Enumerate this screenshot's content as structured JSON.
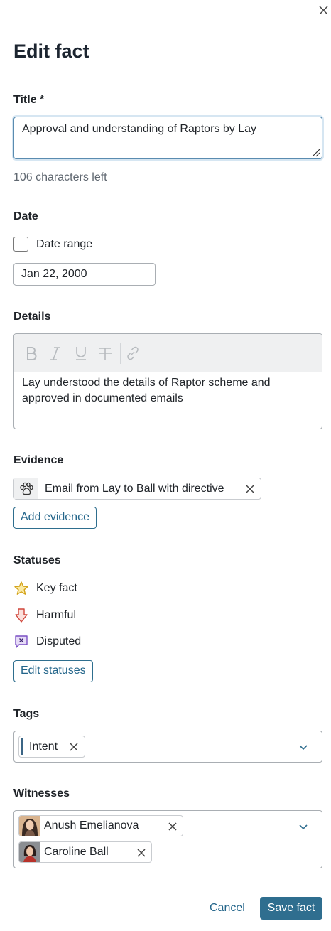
{
  "dialog": {
    "title": "Edit fact"
  },
  "title_field": {
    "label": "Title *",
    "value": "Approval and understanding of Raptors by Lay",
    "hint": "106 characters left"
  },
  "date": {
    "label": "Date",
    "range_checkbox_label": "Date range",
    "range_checked": false,
    "value": "Jan 22, 2000"
  },
  "details": {
    "label": "Details",
    "toolbar": [
      "bold-icon",
      "italic-icon",
      "underline-icon",
      "strikethrough-icon",
      "link-icon"
    ],
    "body": "Lay understood the details of Raptor scheme and approved in documented emails"
  },
  "evidence": {
    "label": "Evidence",
    "items": [
      {
        "icon": "paw-icon",
        "label": "Email from Lay to Ball with directive"
      }
    ],
    "add_button": "Add evidence"
  },
  "statuses": {
    "label": "Statuses",
    "items": [
      {
        "icon": "star-icon",
        "label": "Key fact",
        "color": "#e0b21a"
      },
      {
        "icon": "down-arrow-icon",
        "label": "Harmful",
        "color": "#d0453a"
      },
      {
        "icon": "disputed-bubble-icon",
        "label": "Disputed",
        "color": "#7a4fc4"
      }
    ],
    "edit_button": "Edit statuses"
  },
  "tags": {
    "label": "Tags",
    "items": [
      {
        "label": "Intent",
        "color": "#3b6585"
      }
    ]
  },
  "witnesses": {
    "label": "Witnesses",
    "items": [
      {
        "name": "Anush Emelianova"
      },
      {
        "name": "Caroline Ball"
      }
    ]
  },
  "footer": {
    "cancel": "Cancel",
    "save": "Save fact"
  },
  "colors": {
    "accent": "#2f6e8f",
    "link": "#23658a",
    "focus_border": "#5a8cb0"
  }
}
